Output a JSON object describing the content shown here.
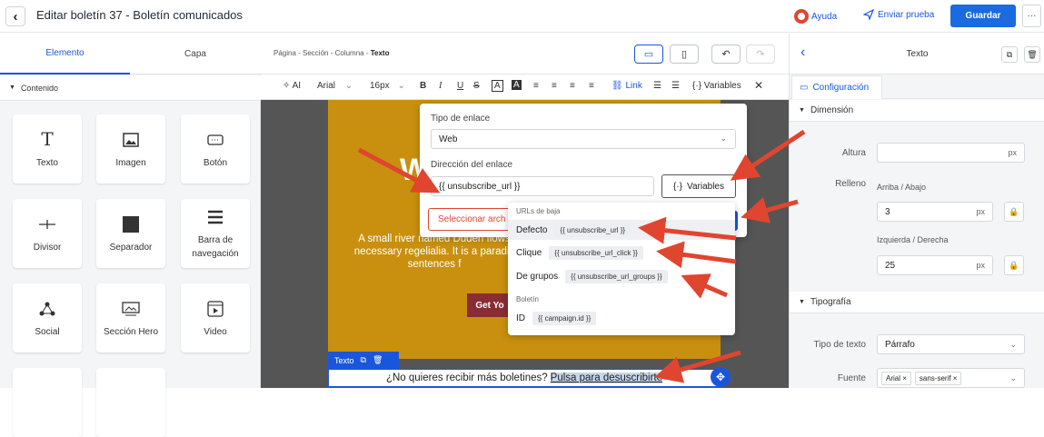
{
  "header": {
    "title": "Editar boletín 37 - Boletín comunicados",
    "help_label": "Ayuda",
    "send_test_label": "Enviar prueba",
    "save_label": "Guardar",
    "more_label": "···"
  },
  "left_panel": {
    "tabs": [
      {
        "label": "Elemento"
      },
      {
        "label": "Capa"
      }
    ],
    "section_title": "Contenido",
    "tiles": [
      {
        "label": "Texto",
        "icon": "T"
      },
      {
        "label": "Imagen",
        "icon": "image-icon"
      },
      {
        "label": "Botón",
        "icon": "button-icon"
      },
      {
        "label": "Divisor",
        "icon": "divider-icon"
      },
      {
        "label": "Separador",
        "icon": "square-icon"
      },
      {
        "label": "Barra de navegación",
        "icon": "menu-icon"
      },
      {
        "label": "Social",
        "icon": "share-icon"
      },
      {
        "label": "Sección Hero",
        "icon": "hero-icon"
      },
      {
        "label": "Video",
        "icon": "video-icon"
      }
    ]
  },
  "canvas": {
    "breadcrumb": {
      "path": "Página - Sección - Columna - ",
      "current": "Texto"
    },
    "toolbar": {
      "ai": "AI",
      "font": "Arial",
      "size": "16px",
      "link": "Link",
      "variables": "Variables"
    },
    "email": {
      "big_text": "W",
      "body": "A small river named Duden flows necessary regelialia. It is a paradis sentences f",
      "button": "Get Yo",
      "footer_text": "¿No quieres recibir más boletines?",
      "footer_link": "Pulsa para desuscribirte",
      "badge": "Texto"
    }
  },
  "link_popup": {
    "type_label": "Tipo de enlace",
    "type_value": "Web",
    "address_label": "Dirección del enlace",
    "address_value": "{{ unsubscribe_url }}",
    "variables_label": "Variables",
    "select_file_label": "Seleccionar arch"
  },
  "variables_dropdown": {
    "groups": [
      {
        "title": "URLs de baja",
        "items": [
          {
            "label": "Defecto",
            "value": "{{ unsubscribe_url }}"
          },
          {
            "label": "Clique",
            "value": "{{ unsubscribe_url_click }}"
          },
          {
            "label": "De grupos",
            "value": "{{ unsubscribe_url_groups }}"
          }
        ]
      },
      {
        "title": "Boletín",
        "items": [
          {
            "label": "ID",
            "value": "{{ campaign.id }}"
          }
        ]
      }
    ]
  },
  "right_panel": {
    "title": "Texto",
    "tab": "Configuración",
    "dimension_section": "Dimensión",
    "height_label": "Altura",
    "height_unit": "px",
    "padding_label": "Relleno",
    "top_bottom_label": "Arriba / Abajo",
    "top_bottom_value": "3",
    "left_right_label": "Izquierda / Derecha",
    "left_right_value": "25",
    "unit": "px",
    "typography_section": "Tipografía",
    "text_type_label": "Tipo de texto",
    "text_type_value": "Párrafo",
    "font_label": "Fuente",
    "font_chips": [
      "Arial ×",
      "sans-serif ×"
    ]
  },
  "colors": {
    "accent": "#1a56db",
    "arrow": "#e0452f",
    "email_bg": "#c8900e"
  }
}
